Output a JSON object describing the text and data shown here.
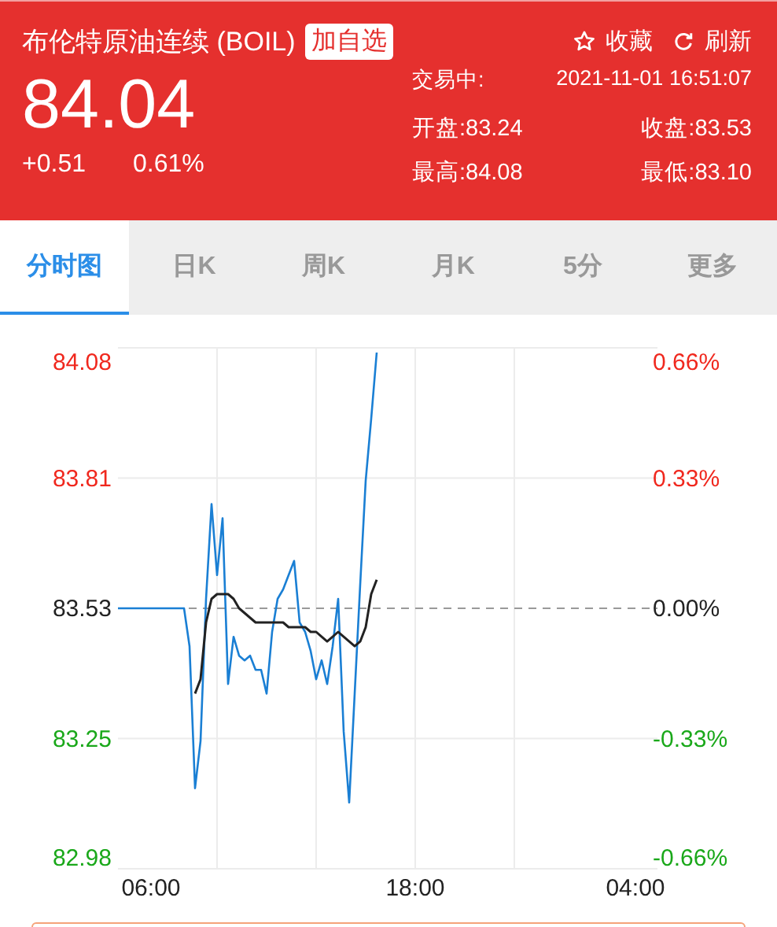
{
  "header": {
    "title": "布伦特原油连续 (BOIL)",
    "watch_button": "加自选",
    "favorite_button": "收藏",
    "refresh_button": "刷新",
    "price": "84.04",
    "change": "+0.51",
    "change_percent": "0.61%",
    "status": "交易中:",
    "timestamp": "2021-11-01 16:51:07",
    "stats": [
      {
        "label": "开盘:83.24"
      },
      {
        "label": "收盘:83.53"
      },
      {
        "label": "最高:84.08"
      },
      {
        "label": "最低:83.10"
      }
    ]
  },
  "tabs": [
    {
      "label": "分时图",
      "selected": true
    },
    {
      "label": "日K",
      "selected": false
    },
    {
      "label": "周K",
      "selected": false
    },
    {
      "label": "月K",
      "selected": false
    },
    {
      "label": "5分",
      "selected": false
    },
    {
      "label": "更多",
      "selected": false
    }
  ],
  "chart": {
    "right_axis": [
      "0.66%",
      "0.33%",
      "0.00%",
      "-0.33%",
      "-0.66%"
    ],
    "chart_data": {
      "type": "line",
      "ylim": [
        82.98,
        84.08
      ],
      "yticks": [
        {
          "value": 84.08,
          "label": "84.08"
        },
        {
          "value": 83.805,
          "label": "83.81"
        },
        {
          "value": 83.53,
          "label": "83.53"
        },
        {
          "value": 83.255,
          "label": "83.25"
        },
        {
          "value": 82.98,
          "label": "82.98"
        }
      ],
      "ref_lines": [
        {
          "axis": "y",
          "value": 83.53
        }
      ],
      "categories": [
        null,
        null,
        null,
        null,
        null,
        null,
        "06:00",
        null,
        null,
        null,
        null,
        null,
        null,
        null,
        null,
        null,
        null,
        null,
        null,
        null,
        null,
        null,
        null,
        null,
        null,
        null,
        null,
        null,
        null,
        null,
        null,
        null,
        null,
        null,
        null,
        null,
        null,
        null,
        null,
        null,
        null,
        null,
        null,
        null,
        null,
        null,
        null,
        null,
        null,
        null,
        null,
        null,
        null,
        null,
        "18:00",
        null,
        null,
        null,
        null,
        null,
        null,
        null,
        null,
        null,
        null,
        null,
        null,
        null,
        null,
        null,
        null,
        null,
        null,
        null,
        null,
        null,
        null,
        null,
        null,
        null,
        null,
        null,
        null,
        null,
        null,
        null,
        null,
        null,
        null,
        null,
        null,
        null,
        null,
        null,
        "04:00",
        null,
        null,
        null,
        null
      ],
      "series": [
        {
          "color": "#1a7fd4",
          "values": [
            83.53,
            83.53,
            83.53,
            83.53,
            83.53,
            83.53,
            83.53,
            83.53,
            83.53,
            83.53,
            83.53,
            83.53,
            83.53,
            83.45,
            83.15,
            83.25,
            83.55,
            83.75,
            83.6,
            83.72,
            83.37,
            83.47,
            83.43,
            83.42,
            83.43,
            83.4,
            83.4,
            83.35,
            83.48,
            83.55,
            83.57,
            83.6,
            83.63,
            83.5,
            83.48,
            83.44,
            83.38,
            83.42,
            83.37,
            83.45,
            83.55,
            83.27,
            83.12,
            83.35,
            83.58,
            83.8,
            83.93,
            84.07,
            null,
            null,
            null,
            null,
            null,
            null,
            null,
            null,
            null,
            null,
            null,
            null,
            null,
            null,
            null,
            null,
            null,
            null,
            null,
            null,
            null,
            null,
            null,
            null,
            null,
            null,
            null,
            null,
            null,
            null,
            null,
            null,
            null,
            null,
            null,
            null,
            null,
            null,
            null,
            null,
            null,
            null,
            null,
            null,
            null,
            null,
            null,
            null,
            null,
            null,
            null
          ]
        },
        {
          "color": "#222222",
          "values": [
            null,
            null,
            null,
            null,
            null,
            null,
            null,
            null,
            null,
            null,
            null,
            null,
            null,
            null,
            83.35,
            83.38,
            83.5,
            83.55,
            83.56,
            83.56,
            83.56,
            83.55,
            83.53,
            83.52,
            83.51,
            83.5,
            83.5,
            83.5,
            83.5,
            83.5,
            83.5,
            83.49,
            83.49,
            83.49,
            83.49,
            83.48,
            83.48,
            83.47,
            83.46,
            83.47,
            83.48,
            83.47,
            83.46,
            83.45,
            83.46,
            83.49,
            83.56,
            83.59,
            null,
            null,
            null,
            null,
            null,
            null,
            null,
            null,
            null,
            null,
            null,
            null,
            null,
            null,
            null,
            null,
            null,
            null,
            null,
            null,
            null,
            null,
            null,
            null,
            null,
            null,
            null,
            null,
            null,
            null,
            null,
            null,
            null,
            null,
            null,
            null,
            null,
            null,
            null,
            null,
            null,
            null,
            null,
            null,
            null,
            null,
            null,
            null,
            null,
            null,
            null
          ]
        }
      ]
    }
  }
}
